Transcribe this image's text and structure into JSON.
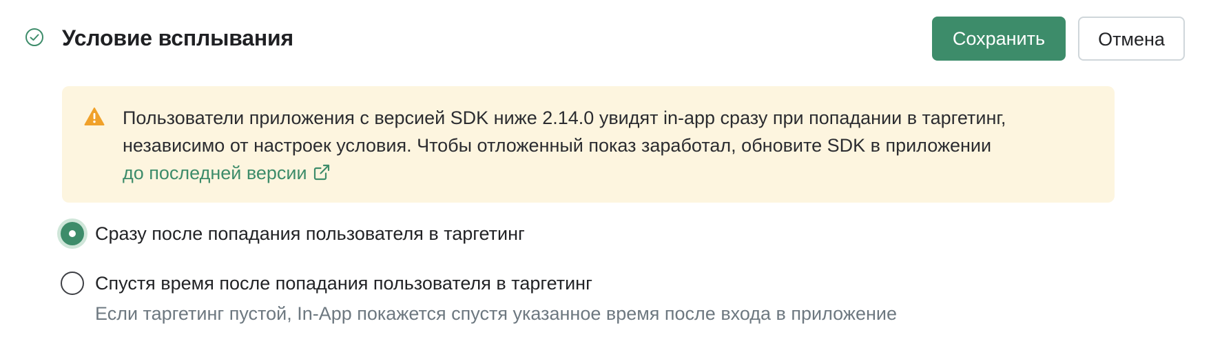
{
  "header": {
    "title": "Условие всплывания",
    "status_icon": "check-circle-icon",
    "save_label": "Сохранить",
    "cancel_label": "Отмена"
  },
  "alert": {
    "icon": "warning-triangle-icon",
    "text": "Пользователи приложения с версией SDK ниже 2.14.0 увидят in-app сразу при попадании в таргетинг, независимо от настроек условия. Чтобы отложенный показ заработал, обновите SDK в приложении ",
    "link_text": "до последней версии",
    "link_icon": "external-link-icon"
  },
  "options": [
    {
      "label": "Сразу после попадания пользователя в таргетинг",
      "selected": true
    },
    {
      "label": "Спустя время после попадания пользователя в таргетинг",
      "hint": "Если таргетинг пустой, In-App покажется спустя указанное время после входа в приложение",
      "selected": false
    }
  ],
  "colors": {
    "accent": "#3d8c6a",
    "alert_bg": "#fdf5df",
    "warning": "#f0a12a",
    "hint_text": "#6d7880"
  }
}
